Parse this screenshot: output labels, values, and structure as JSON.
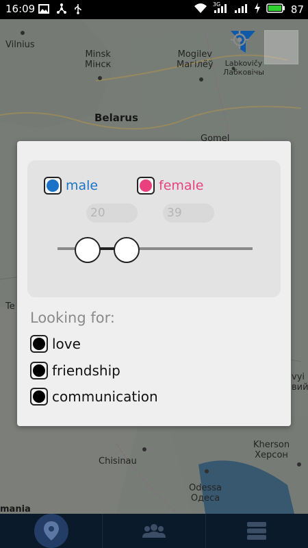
{
  "status_bar": {
    "time": "16:09",
    "signal_badge": "3G",
    "battery": "87"
  },
  "map": {
    "labels": {
      "vilnius": "Vilnius",
      "minsk": "Minsk",
      "minsk_local": "Мінск",
      "mogilev": "Mogilev",
      "mogilev_local": "Магілёў",
      "labkovichy": "Labkovičy",
      "labkovichy_local": "Лабковічы",
      "belarus": "Belarus",
      "gomel": "Gomel",
      "chisinau": "Chisinau",
      "odessa": "Odessa",
      "odessa_local": "Одеса",
      "kherson": "Kherson",
      "kherson_local": "Херсон",
      "romania_partial": "mania",
      "edge_te": "Te",
      "edge_vyi": "vyi",
      "edge_viy": "вий"
    }
  },
  "filter_dialog": {
    "gender": {
      "male_label": "male",
      "female_label": "female",
      "male_color": "#1a73c8",
      "female_color": "#e8417d"
    },
    "age": {
      "min_placeholder": "20",
      "max_placeholder": "39",
      "slider_min_value": 20,
      "slider_max_value": 39
    },
    "looking_for": {
      "title": "Looking for:",
      "options": [
        "love",
        "friendship",
        "communication"
      ]
    }
  },
  "colors": {
    "nav_background": "#0b1a2b",
    "nav_active": "#233d66",
    "filter_icon": "#0e5aa8"
  },
  "bottom_nav": {
    "items": [
      "map-pin-icon",
      "people-icon",
      "list-icon"
    ]
  }
}
